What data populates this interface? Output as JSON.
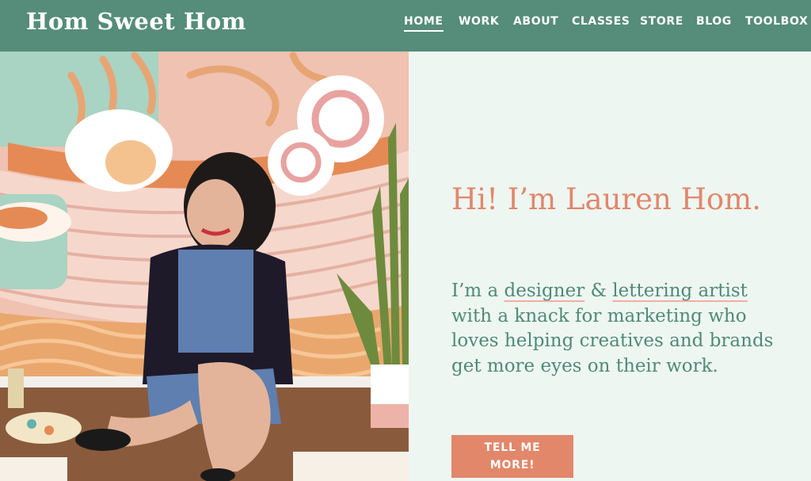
{
  "header": {
    "logo": "Hom Sweet Hom",
    "nav": [
      {
        "label": "HOME",
        "active": true
      },
      {
        "label": "WORK"
      },
      {
        "label": "ABOUT"
      },
      {
        "label": "CLASSES"
      },
      {
        "label": "STORE"
      },
      {
        "label": "BLOG"
      },
      {
        "label": "TOOLBOX"
      }
    ]
  },
  "hero": {
    "greeting": "Hi! I’m Lauren Hom.",
    "intro": {
      "p1": "I’m a ",
      "l1": "designer",
      "p2": " & ",
      "l2": "lettering artist",
      "p3": " with a knack for marketing who loves helping creatives and brands get more eyes on their work."
    },
    "cta": "TELL ME MORE!"
  },
  "colors": {
    "header_bg": "#558c7a",
    "accent": "#e2876a",
    "text_green": "#4f8a77",
    "panel_bg": "#eef6f2"
  }
}
